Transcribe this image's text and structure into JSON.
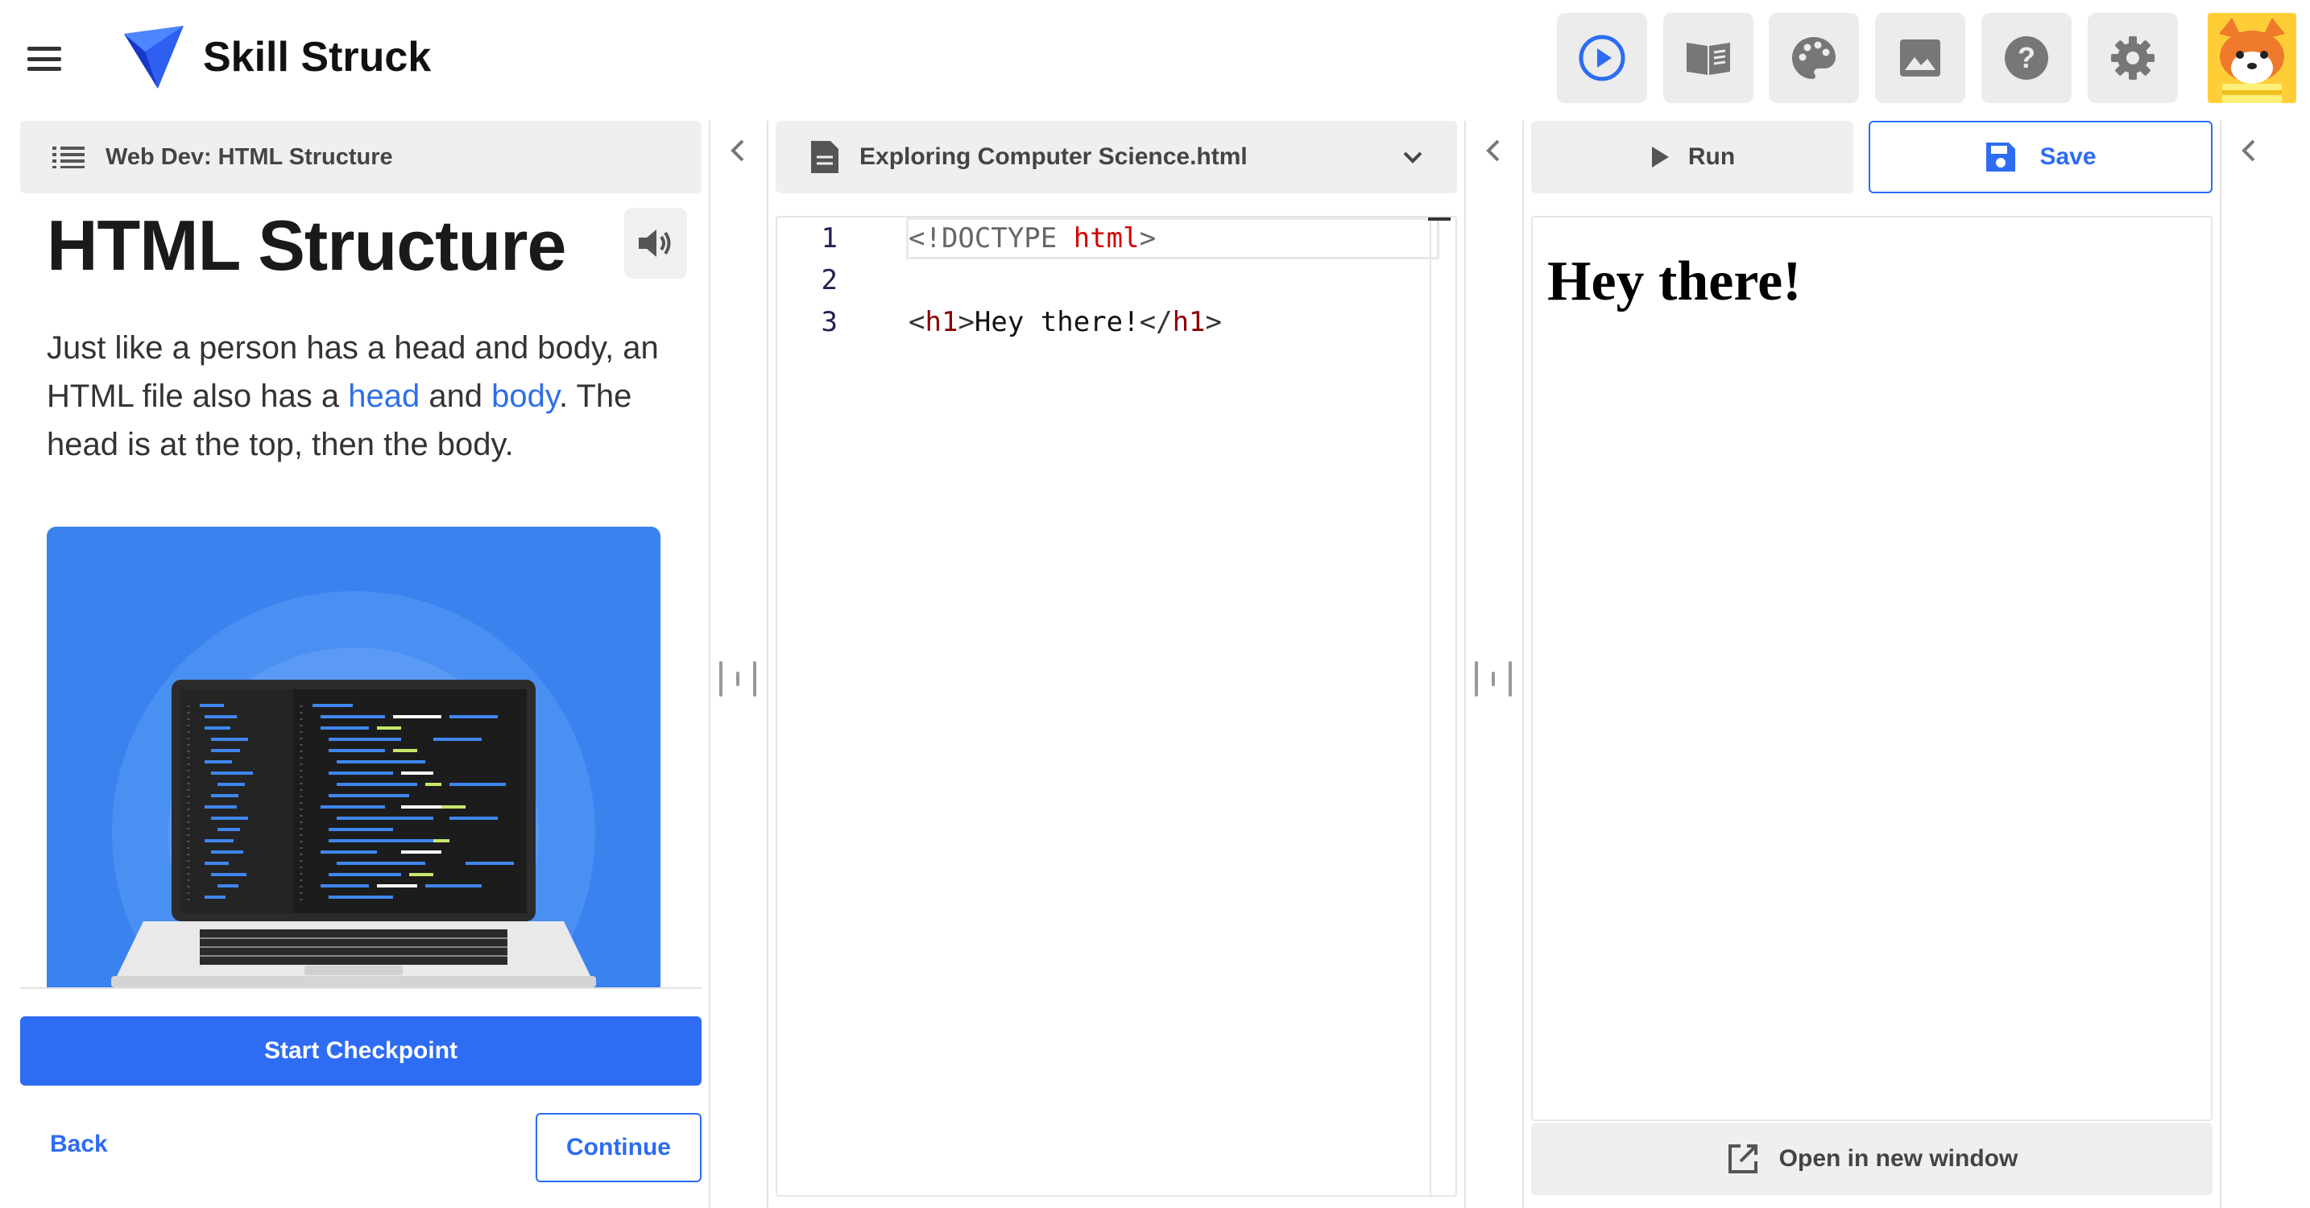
{
  "app": {
    "brand": "Skill Struck",
    "accent_color": "#2d6cf3",
    "toolbar_icons": [
      "play-circle-icon",
      "book-icon",
      "palette-icon",
      "image-icon",
      "help-icon",
      "gear-icon"
    ]
  },
  "lesson": {
    "breadcrumb": "Web Dev: HTML Structure",
    "title": "HTML Structure",
    "text_part1": "Just like a person has a head and body, an HTML file also has a ",
    "link_head": "head",
    "text_and": " and ",
    "link_body": "body",
    "text_part2": ". The head is at the top, then the body.",
    "start_checkpoint": "Start Checkpoint",
    "back": "Back",
    "continue": "Continue"
  },
  "editor": {
    "filename": "Exploring Computer Science.html",
    "lines": [
      {
        "num": "1",
        "text": "<!DOCTYPE html>"
      },
      {
        "num": "2",
        "text": ""
      },
      {
        "num": "3",
        "text": "<h1>Hey there!</h1>"
      }
    ]
  },
  "preview": {
    "run_label": "Run",
    "save_label": "Save",
    "heading": "Hey there!",
    "open_new_window": "Open in new window"
  }
}
